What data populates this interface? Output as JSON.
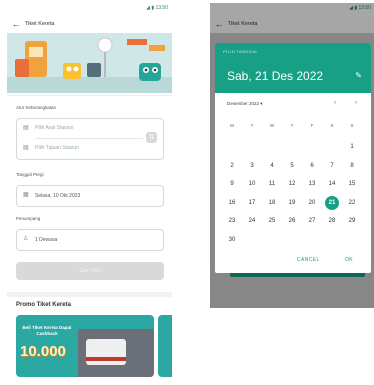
{
  "left_screen": {
    "status_time": "◢ ▮ 13:50",
    "title": "Tiket Kereta",
    "form": {
      "departure_label": "Atur Keberangkatan",
      "origin_placeholder": "Pilih Asal Stasiun",
      "destination_placeholder": "Pilih Tujuan Stasiun",
      "date_label": "Tanggal Pergi",
      "date_value": "Selasa, 10 Okt 2023",
      "passenger_label": "Penumpang",
      "passenger_value": "1 Dewasa",
      "search_button": "Cari Tiket"
    },
    "promo": {
      "title": "Promo Tiket Kereta",
      "card_text": "Beli Tiket Kereta Dapat Cashback",
      "card_amount": "10.000"
    }
  },
  "right_screen": {
    "status_time": "◢ ▮ 13:50",
    "title": "Tiket Kereta",
    "dialog": {
      "header_label": "PILIH TANGGAL",
      "selected_date": "Sab, 21 Des 2022",
      "month_year": "Desember 2022",
      "weekdays": [
        "M",
        "T",
        "W",
        "T",
        "F",
        "S",
        "S"
      ],
      "days": [
        "1",
        "2",
        "3",
        "4",
        "5",
        "6",
        "7",
        "8",
        "9",
        "10",
        "11",
        "12",
        "13",
        "14",
        "15",
        "16",
        "17",
        "18",
        "19",
        "20",
        "21",
        "22",
        "23",
        "24",
        "25",
        "26",
        "27",
        "28",
        "29",
        "30"
      ],
      "selected_day": "21",
      "cancel": "CANCEL",
      "ok": "OK"
    }
  },
  "colors": {
    "accent": "#17a086",
    "disabled": "#d9d9d9"
  }
}
